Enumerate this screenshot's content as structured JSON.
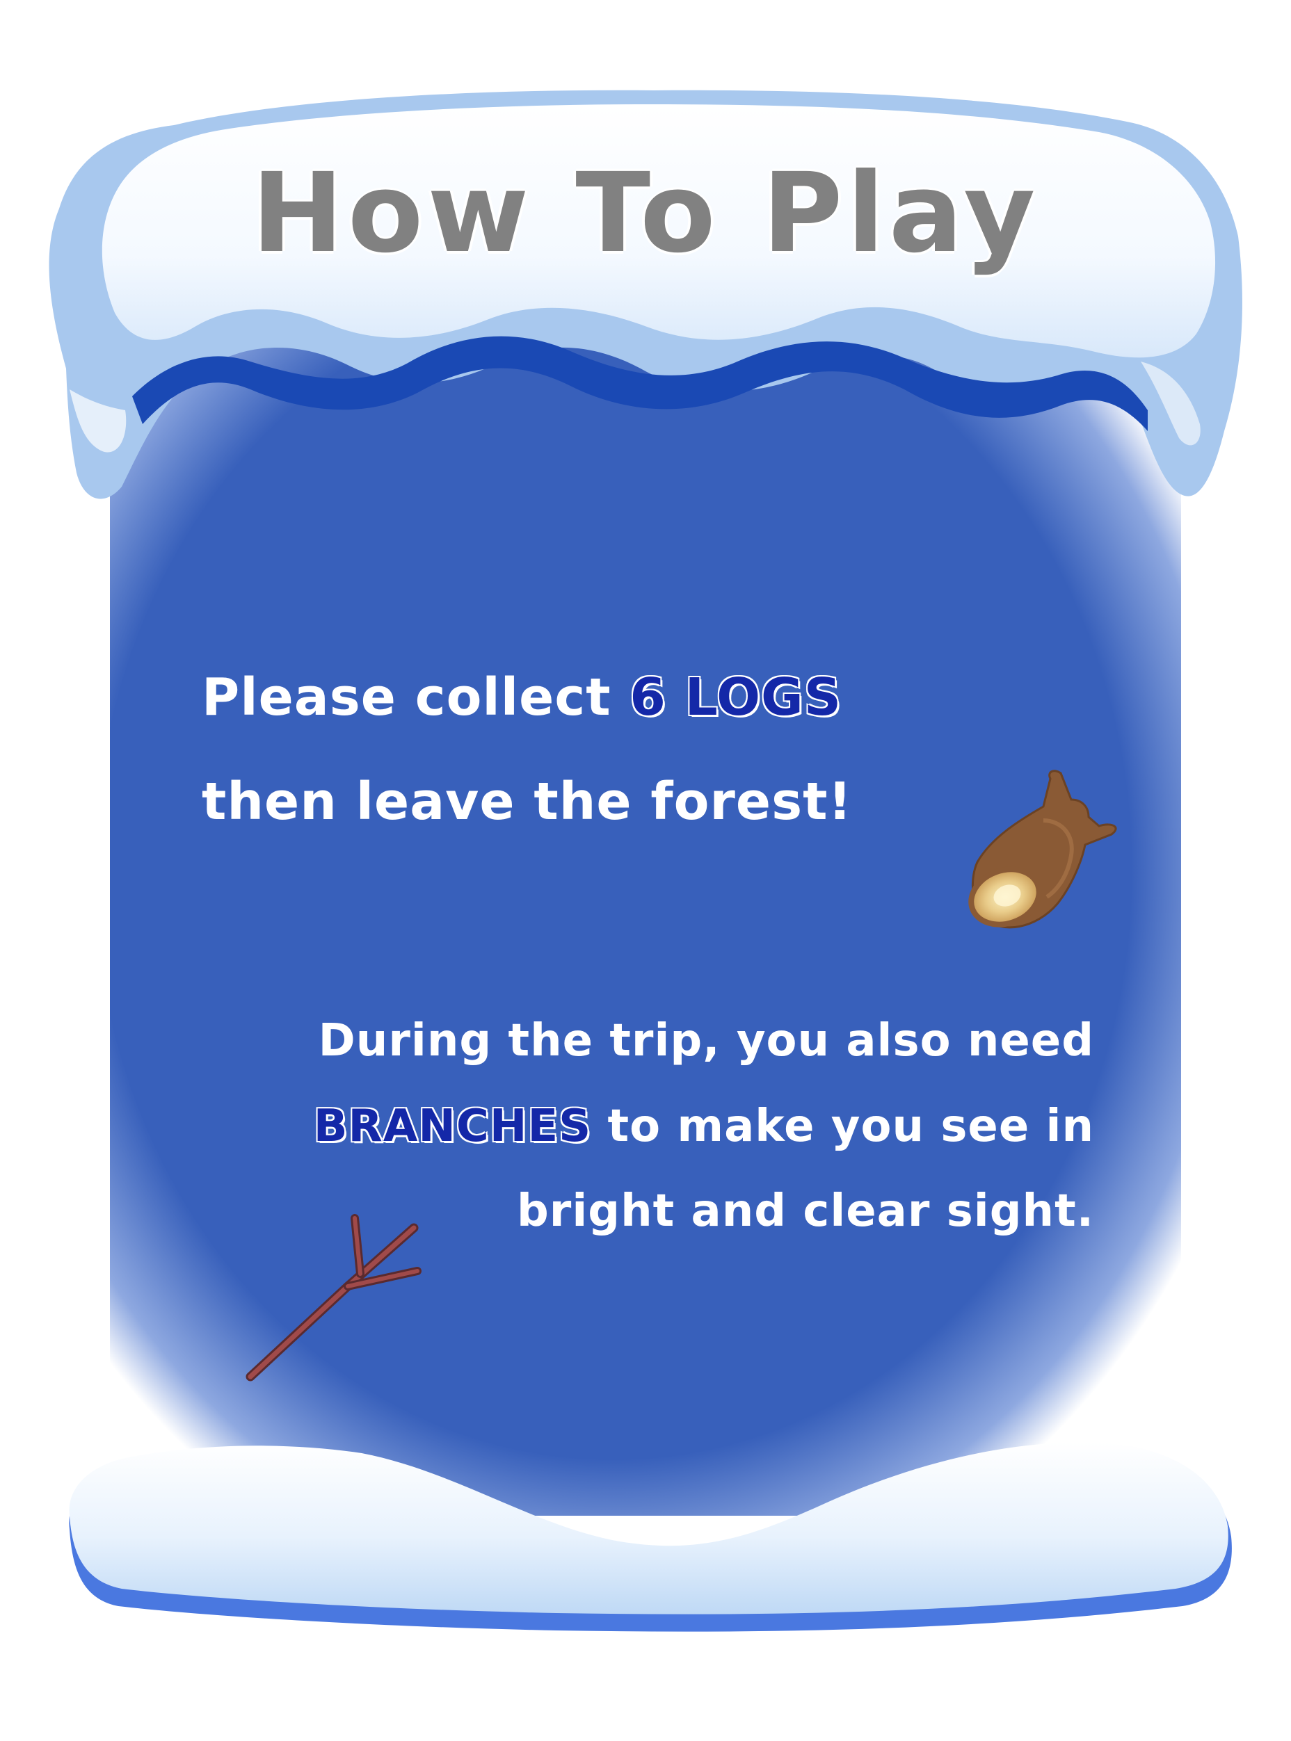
{
  "title": "How To Play",
  "instructions": {
    "line1": {
      "prefix": "Please collect ",
      "highlight": "6 LOGS"
    },
    "line2": "then leave the forest!",
    "line3": "During the trip, you also need",
    "line4": {
      "highlight": "BRANCHES",
      "suffix": " to make you see in"
    },
    "line5": "bright and clear sight."
  },
  "icons": {
    "log": "log-icon",
    "branch": "branch-icon"
  },
  "colors": {
    "panel": "#3860bb",
    "snow": "#ffffff",
    "snow_shadow": "#a8c8ee",
    "title_text": "#818181",
    "highlight_text": "#1428a8",
    "body_text": "#ffffff"
  }
}
